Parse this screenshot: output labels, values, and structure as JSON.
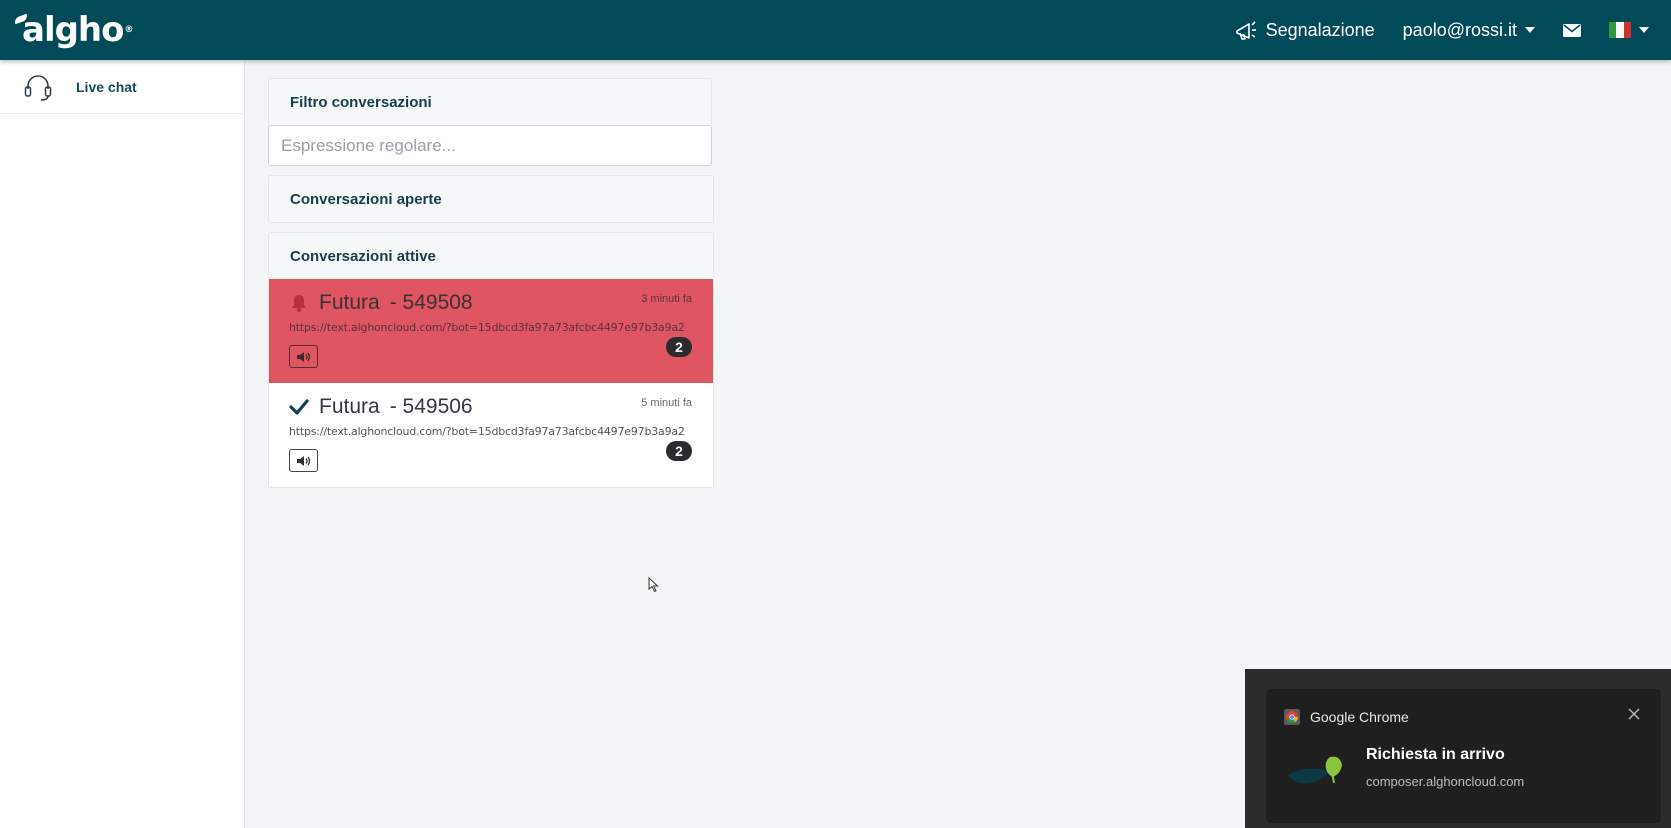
{
  "header": {
    "logo": "algho",
    "report_label": "Segnalazione",
    "user_email": "paolo@rossi.it",
    "flag_colors": [
      "#2f9a41",
      "#ffffff",
      "#d0312d"
    ]
  },
  "sidebar": {
    "items": [
      {
        "label": "Live chat",
        "icon": "headset-icon"
      }
    ]
  },
  "filter": {
    "title": "Filtro conversazioni",
    "placeholder": "Espressione regolare..."
  },
  "open_conversations": {
    "title": "Conversazioni aperte"
  },
  "active_conversations": {
    "title": "Conversazioni attive",
    "items": [
      {
        "name": "Futura",
        "id": "- 549508",
        "time": "3 minuti fa",
        "url": "https://text.alghoncloud.com/?bot=15dbcd3fa97a73afcbc4497e97b3a9a2",
        "count": "2",
        "status": "alert",
        "bg_color": "#e05562"
      },
      {
        "name": "Futura",
        "id": "- 549506",
        "time": "5 minuti fa",
        "url": "https://text.alghoncloud.com/?bot=15dbcd3fa97a73afcbc4497e97b3a9a2",
        "count": "2",
        "status": "ok",
        "bg_color": "#ffffff"
      }
    ]
  },
  "notification": {
    "app": "Google Chrome",
    "title": "Richiesta in arrivo",
    "source": "composer.alghoncloud.com"
  }
}
